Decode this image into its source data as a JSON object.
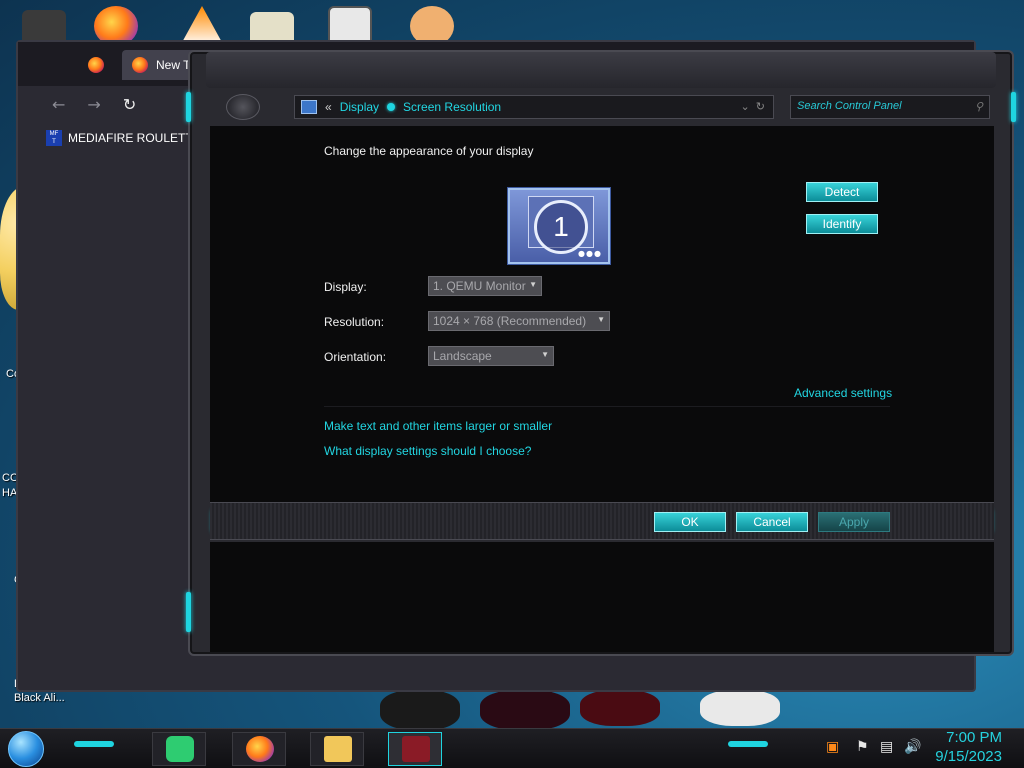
{
  "desktop": {
    "labels": [
      "Co",
      "COI",
      "HAT",
      "C",
      "L",
      "Black Ali..."
    ]
  },
  "browser": {
    "tab_title": "New Tab",
    "bookmark_label": "MEDIAFIRE ROULETTER",
    "bookmark_icon_text": "MF\nT",
    "nav": {
      "back": "←",
      "forward": "→",
      "reload": "↻"
    }
  },
  "control_panel": {
    "breadcrumb": {
      "back_glyph": "«",
      "items": [
        "Display",
        "Screen Resolution"
      ]
    },
    "search_placeholder": "Search Control Panel",
    "heading": "Change the appearance of your display",
    "monitor_number": "1",
    "buttons": {
      "detect": "Detect",
      "identify": "Identify",
      "ok": "OK",
      "cancel": "Cancel",
      "apply": "Apply"
    },
    "fields": {
      "display": {
        "label": "Display:",
        "value": "1. QEMU Monitor"
      },
      "resolution": {
        "label": "Resolution:",
        "value": "1024 × 768 (Recommended)"
      },
      "orientation": {
        "label": "Orientation:",
        "value": "Landscape"
      }
    },
    "links": {
      "advanced": "Advanced settings",
      "text_size": "Make text and other items larger or smaller",
      "help": "What display settings should I choose?"
    }
  },
  "taskbar": {
    "time": "7:00 PM",
    "date": "9/15/2023"
  },
  "colors": {
    "accent": "#1fd4e0",
    "link": "#22d6e2",
    "window_bg": "#0a0a0b"
  }
}
